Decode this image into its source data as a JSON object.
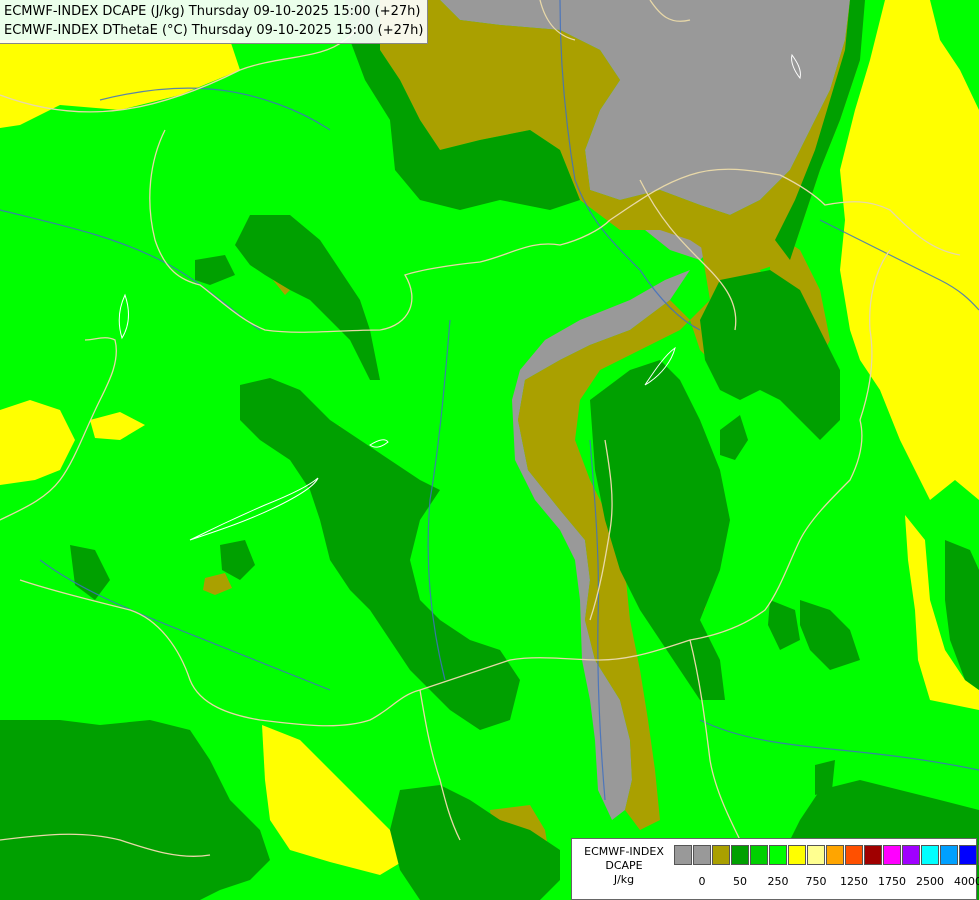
{
  "title_lines": [
    "ECMWF-INDEX DCAPE (J/kg) Thursday 09-10-2025 15:00 (+27h)",
    "ECMWF-INDEX DThetaE (°C) Thursday 09-10-2025 15:00 (+27h)"
  ],
  "legend": {
    "title_lines": [
      "ECMWF-INDEX",
      "DCAPE",
      "J/kg"
    ],
    "swatch_colors": [
      "#999999",
      "#999999",
      "#aaa000",
      "#00a000",
      "#00d000",
      "#00ff00",
      "#ffff00",
      "#ffff90",
      "#ffa500",
      "#ff5000",
      "#a00000",
      "#ff00ff",
      "#a000ff",
      "#00ffff",
      "#00a0ff",
      "#0000ff",
      "#000080"
    ],
    "tick_labels": [
      "0",
      "50",
      "250",
      "750",
      "1250",
      "1750",
      "2500",
      "4000"
    ]
  },
  "colors": {
    "green_bright": "#00ff00",
    "green_mid": "#00a000",
    "olive": "#aaa000",
    "gray": "#999999",
    "yellow": "#ffff00",
    "border": "#e8d8a8",
    "river": "#4070c0"
  }
}
